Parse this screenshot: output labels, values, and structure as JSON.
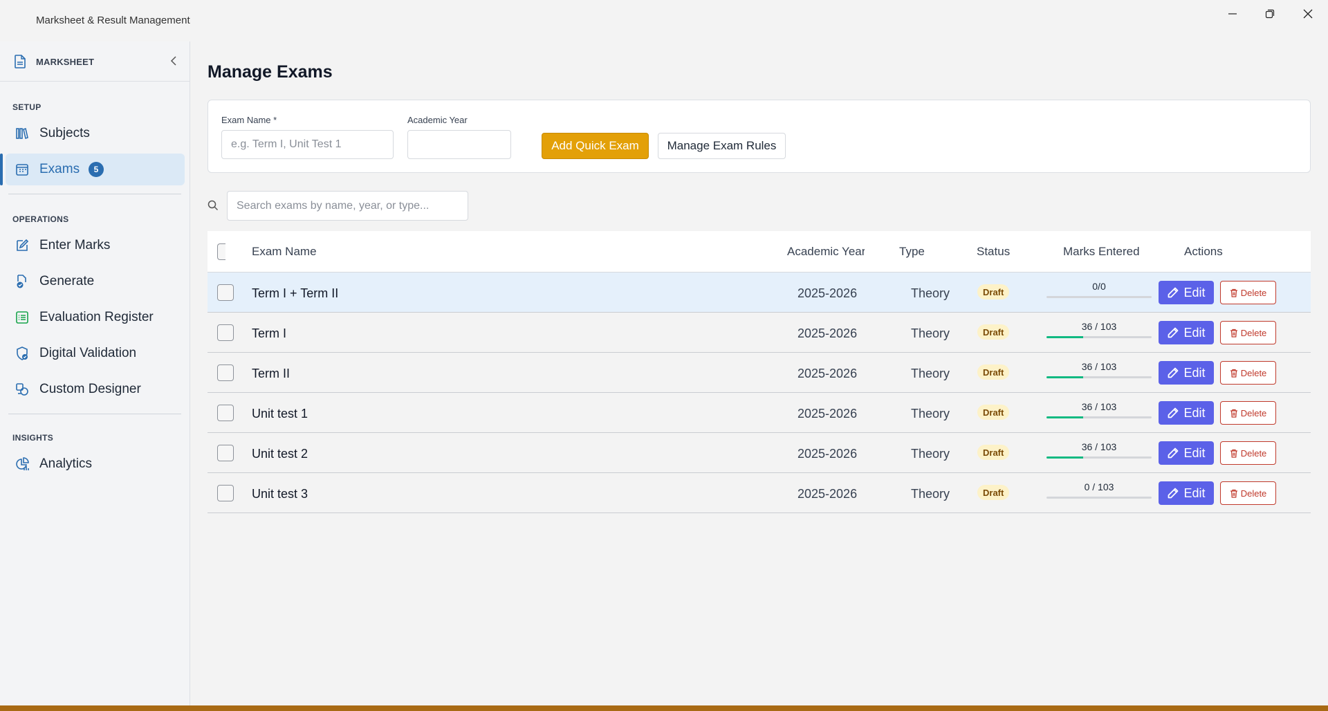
{
  "window": {
    "title": "Marksheet & Result Management"
  },
  "sidebar": {
    "brand": "MARKSHEET",
    "sections": {
      "setup": "SETUP",
      "operations": "OPERATIONS",
      "insights": "INSIGHTS"
    },
    "items": [
      {
        "label": "Subjects",
        "icon": "books-icon"
      },
      {
        "label": "Exams",
        "icon": "calendar-icon",
        "badge": "5",
        "active": true
      },
      {
        "label": "Enter Marks",
        "icon": "edit-icon"
      },
      {
        "label": "Generate",
        "icon": "generate-doc-icon"
      },
      {
        "label": "Evaluation Register",
        "icon": "list-icon"
      },
      {
        "label": "Digital Validation",
        "icon": "shield-check-icon"
      },
      {
        "label": "Custom Designer",
        "icon": "designer-icon"
      },
      {
        "label": "Analytics",
        "icon": "analytics-icon"
      }
    ]
  },
  "main": {
    "title": "Manage Exams",
    "form": {
      "exam_name_label": "Exam Name *",
      "exam_name_placeholder": "e.g. Term I, Unit Test 1",
      "academic_year_label": "Academic Year",
      "academic_year_value": "",
      "add_button": "Add Quick Exam",
      "rules_button": "Manage Exam Rules"
    },
    "search": {
      "placeholder": "Search exams by name, year, or type..."
    },
    "table": {
      "headers": {
        "name": "Exam Name",
        "year": "Academic Year",
        "type": "Type",
        "status": "Status",
        "marks": "Marks Entered",
        "actions": "Actions"
      },
      "rows": [
        {
          "name": "Term I + Term II",
          "year": "2025-2026",
          "type": "Theory",
          "status": "Draft",
          "marks": "0/0",
          "progress": 0,
          "selected": true
        },
        {
          "name": "Term I",
          "year": "2025-2026",
          "type": "Theory",
          "status": "Draft",
          "marks": "36 / 103",
          "progress": 0.35
        },
        {
          "name": "Term II",
          "year": "2025-2026",
          "type": "Theory",
          "status": "Draft",
          "marks": "36 / 103",
          "progress": 0.35
        },
        {
          "name": "Unit test 1",
          "year": "2025-2026",
          "type": "Theory",
          "status": "Draft",
          "marks": "36 / 103",
          "progress": 0.35
        },
        {
          "name": "Unit test 2",
          "year": "2025-2026",
          "type": "Theory",
          "status": "Draft",
          "marks": "36 / 103",
          "progress": 0.35
        },
        {
          "name": "Unit test 3",
          "year": "2025-2026",
          "type": "Theory",
          "status": "Draft",
          "marks": "0 / 103",
          "progress": 0
        }
      ],
      "edit_label": "Edit",
      "delete_label": "Delete"
    }
  },
  "colors": {
    "accent": "#2a6db0",
    "primary_button": "#e3a008",
    "edit_button": "#5b61e8",
    "delete": "#c0392b",
    "progress": "#10b981",
    "draft_badge_bg": "#fdf2c8"
  }
}
